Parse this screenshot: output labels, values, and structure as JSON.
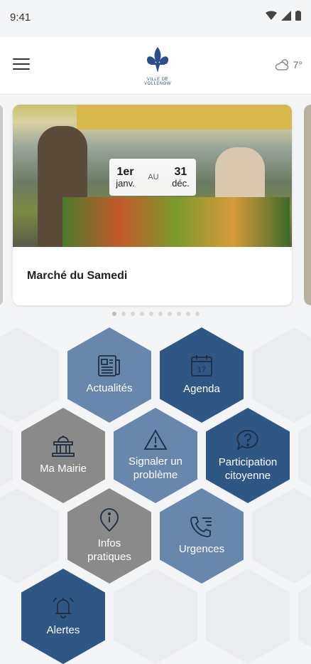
{
  "status": {
    "time": "9:41"
  },
  "header": {
    "logo_text": "VILLE DE VOLLENOW",
    "weather_temp": "7°"
  },
  "event": {
    "start_day": "1er",
    "start_month": "janv.",
    "separator": "AU",
    "end_day": "31",
    "end_month": "déc.",
    "title": "Marché du Samedi"
  },
  "carousel": {
    "dots": 10,
    "active": 0
  },
  "tiles": {
    "actualites": "Actualités",
    "agenda": "Agenda",
    "agenda_day": "17",
    "mairie": "Ma Mairie",
    "signaler": "Signaler un problème",
    "participation": "Participation citoyenne",
    "infos": "Infos pratiques",
    "urgences": "Urgences",
    "alertes": "Alertes"
  },
  "colors": {
    "light_blue": "#6887ad",
    "dark_blue": "#2f5785",
    "gray": "#8a8a8a",
    "bg_hex": "#ebecef"
  }
}
